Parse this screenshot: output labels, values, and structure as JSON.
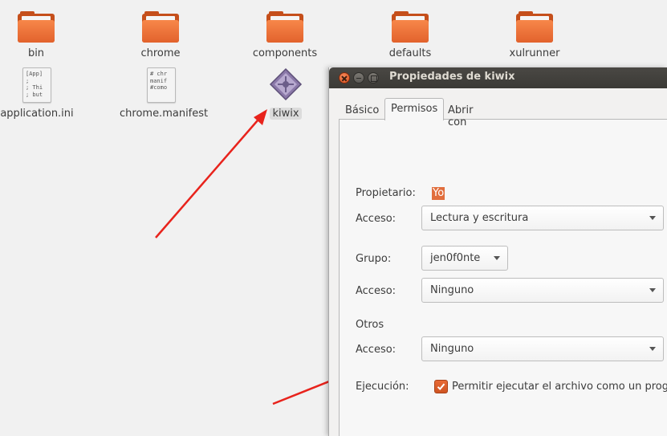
{
  "desktop": {
    "folders": [
      {
        "label": "bin"
      },
      {
        "label": "chrome"
      },
      {
        "label": "components"
      },
      {
        "label": "defaults"
      },
      {
        "label": "xulrunner"
      }
    ],
    "files": [
      {
        "label": "application.ini",
        "preview": [
          "[App]",
          ";",
          "; Thi",
          "; but"
        ]
      },
      {
        "label": "chrome.manifest",
        "preview": [
          "# chr",
          "manif",
          "",
          "#como"
        ]
      },
      {
        "label": "kiwix",
        "icon": "executable-icon"
      }
    ]
  },
  "dialog": {
    "title": "Propiedades de kiwix",
    "tabs": [
      {
        "label": "Básico"
      },
      {
        "label": "Permisos",
        "active": true
      },
      {
        "label": "Abrir con"
      }
    ],
    "owner": {
      "label": "Propietario:",
      "value": "Yo"
    },
    "owner_access": {
      "label": "Acceso:",
      "value": "Lectura y escritura"
    },
    "group": {
      "label": "Grupo:",
      "value": "jen0f0nte"
    },
    "group_access": {
      "label": "Acceso:",
      "value": "Ninguno"
    },
    "others": {
      "label": "Otros"
    },
    "others_access": {
      "label": "Acceso:",
      "value": "Ninguno"
    },
    "execution": {
      "label": "Ejecución:",
      "checkbox_label": "Permitir ejecutar el archivo como un programa",
      "checked": true
    }
  },
  "colors": {
    "accent": "#e16e3d",
    "arrow": "#e8231c",
    "titlebar": "#3f3e3a",
    "folder": "#e8692f"
  }
}
